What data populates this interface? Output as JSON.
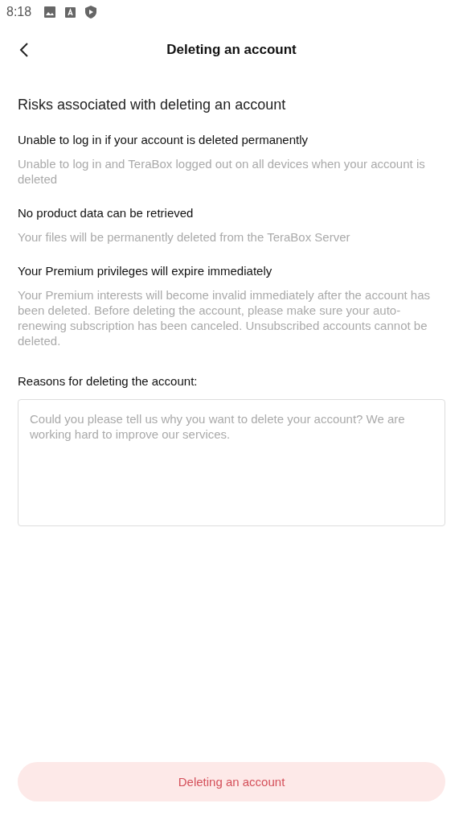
{
  "status_bar": {
    "time": "8:18"
  },
  "header": {
    "title": "Deleting an account"
  },
  "section_title": "Risks associated with deleting an account",
  "risks": [
    {
      "title": "Unable to log in if your account is deleted permanently",
      "description": "Unable to log in and TeraBox logged out on all devices when your account is deleted"
    },
    {
      "title": "No product data can be retrieved",
      "description": "Your files will be permanently deleted from the TeraBox Server"
    },
    {
      "title": "Your Premium privileges will expire immediately",
      "description": "Your Premium interests will become invalid immediately after the account has been deleted. Before deleting the account, please make sure your auto-renewing subscription has been canceled. Unsubscribed accounts cannot be deleted."
    }
  ],
  "reasons": {
    "label": "Reasons for deleting the account:",
    "placeholder": "Could you please tell us why you want to delete your account? We are working hard to improve our services."
  },
  "delete_button": {
    "label": "Deleting an account",
    "disabled": true
  }
}
